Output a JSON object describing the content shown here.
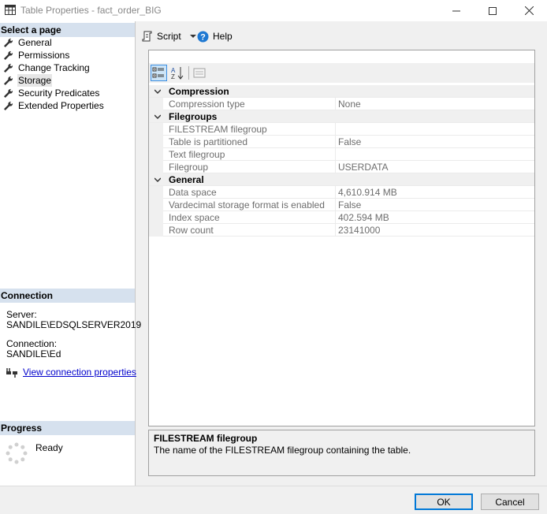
{
  "window": {
    "title": "Table Properties - fact_order_BIG"
  },
  "left": {
    "select_header": "Select a page",
    "pages": [
      {
        "label": "General",
        "selected": false
      },
      {
        "label": "Permissions",
        "selected": false
      },
      {
        "label": "Change Tracking",
        "selected": false
      },
      {
        "label": "Storage",
        "selected": true
      },
      {
        "label": "Security Predicates",
        "selected": false
      },
      {
        "label": "Extended Properties",
        "selected": false
      }
    ],
    "connection_header": "Connection",
    "server_label": "Server:",
    "server_value": "SANDILE\\EDSQLSERVER2019",
    "connection_label": "Connection:",
    "connection_value": "SANDILE\\Ed",
    "view_connection_link": "View connection properties",
    "progress_header": "Progress",
    "progress_status": "Ready"
  },
  "toolbar": {
    "script_label": "Script",
    "help_label": "Help"
  },
  "grid": {
    "categories": [
      {
        "name": "Compression",
        "rows": [
          {
            "name": "Compression type",
            "value": "None"
          }
        ]
      },
      {
        "name": "Filegroups",
        "rows": [
          {
            "name": "FILESTREAM filegroup",
            "value": ""
          },
          {
            "name": "Table is partitioned",
            "value": "False"
          },
          {
            "name": "Text filegroup",
            "value": ""
          },
          {
            "name": "Filegroup",
            "value": "USERDATA"
          }
        ]
      },
      {
        "name": "General",
        "rows": [
          {
            "name": "Data space",
            "value": "4,610.914 MB"
          },
          {
            "name": "Vardecimal storage format is enabled",
            "value": "False"
          },
          {
            "name": "Index space",
            "value": "402.594 MB"
          },
          {
            "name": "Row count",
            "value": "23141000"
          }
        ]
      }
    ]
  },
  "description": {
    "title": "FILESTREAM filegroup",
    "text": "The name of the FILESTREAM filegroup containing the table."
  },
  "buttons": {
    "ok": "OK",
    "cancel": "Cancel"
  },
  "colors": {
    "section_header_bg": "#d6e1ee",
    "link": "#0000cc",
    "ok_border": "#0078d7"
  }
}
